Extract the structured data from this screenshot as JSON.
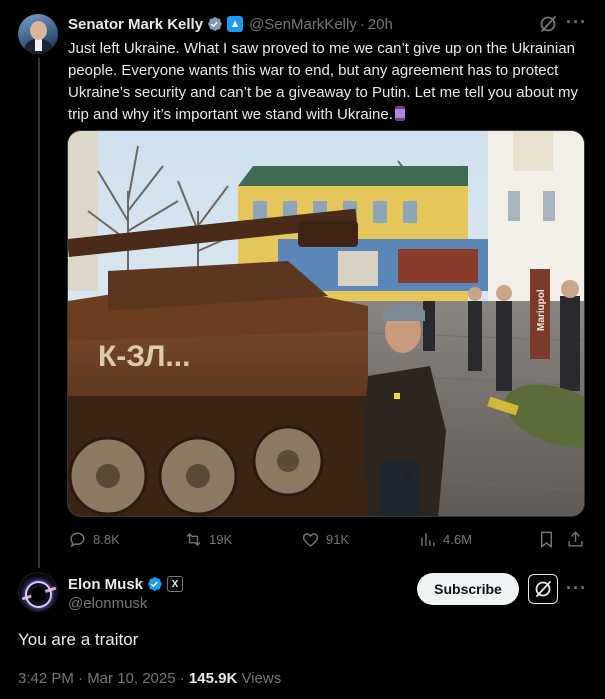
{
  "parent_tweet": {
    "display_name": "Senator Mark Kelly",
    "handle": "@SenMarkKelly",
    "separator": "·",
    "time": "20h",
    "text": "Just left Ukraine. What I saw proved to me we can’t give up on the Ukrainian people. Everyone wants this war to end, but any agreement has to protect Ukraine’s security and can’t be a giveaway to Putin. Let me tell you about my trip and why it’s important we stand with Ukraine.",
    "text_emoji": "spool-of-thread",
    "photo": {
      "tank_marking": "К-ЗЛ...",
      "sign_text": "Mariupol"
    },
    "stats": {
      "replies": "8.8K",
      "reposts": "19K",
      "likes": "91K",
      "views": "4.6M"
    },
    "more_label": "···"
  },
  "reply_tweet": {
    "display_name": "Elon Musk",
    "x_badge": "X",
    "handle": "@elonmusk",
    "subscribe_label": "Subscribe",
    "more_label": "···",
    "text": "You are a traitor",
    "timestamp": "3:42 PM · Mar 10, 2025 · ",
    "views_count": "145.9K",
    "views_label": " Views"
  },
  "colors": {
    "background": "#000000",
    "text": "#e7e9ea",
    "muted": "#71767b",
    "verified_blue": "#1d9bf0",
    "button_bg": "#eff3f4"
  },
  "icons": [
    "verified-icon",
    "gov-badge-icon",
    "grok-icon",
    "more-icon",
    "reply-icon",
    "repost-icon",
    "like-icon",
    "views-icon",
    "bookmark-icon",
    "share-icon",
    "x-badge-icon"
  ]
}
